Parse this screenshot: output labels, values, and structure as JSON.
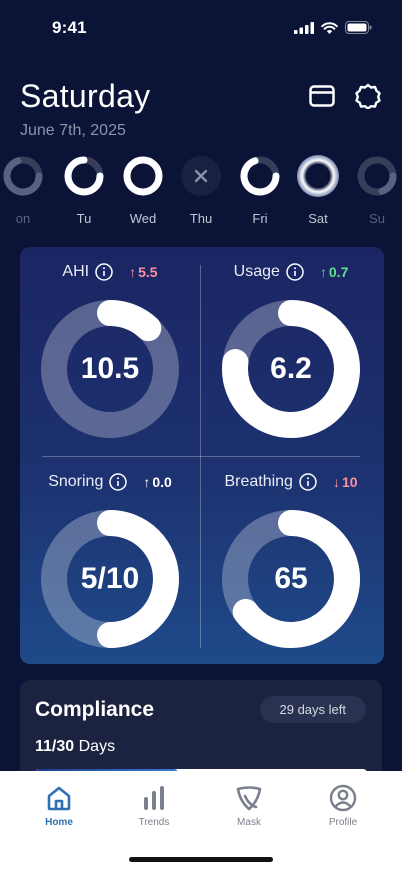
{
  "status_bar": {
    "time": "9:41"
  },
  "header": {
    "day": "Saturday",
    "date": "June 7th, 2025"
  },
  "week": [
    {
      "label": "Mon",
      "display": "on",
      "state": "partial",
      "progress": 0.7,
      "faded": true
    },
    {
      "label": "Tu",
      "display": "Tu",
      "state": "partial",
      "progress": 0.75
    },
    {
      "label": "Wed",
      "display": "Wed",
      "state": "full",
      "progress": 1.0
    },
    {
      "label": "Thu",
      "display": "Thu",
      "state": "missed",
      "progress": 0
    },
    {
      "label": "Fri",
      "display": "Fri",
      "state": "partial",
      "progress": 0.7
    },
    {
      "label": "Sat",
      "display": "Sat",
      "state": "selected",
      "progress": 1.0
    },
    {
      "label": "Sun",
      "display": "Su",
      "state": "partial",
      "progress": 0.2,
      "faded": true
    }
  ],
  "metrics": {
    "ahi": {
      "name": "AHI",
      "value": "10.5",
      "delta": "5.5",
      "direction": "up",
      "delta_color": "#ff8fa3",
      "progress": 0.12
    },
    "usage": {
      "name": "Usage",
      "value": "6.2",
      "delta": "0.7",
      "direction": "up",
      "delta_color": "#5ee28a",
      "progress": 0.77
    },
    "snoring": {
      "name": "Snoring",
      "value": "5/10",
      "delta": "0.0",
      "direction": "up",
      "delta_color": "#ffffff",
      "progress": 0.5
    },
    "breathing": {
      "name": "Breathing",
      "value": "65",
      "delta": "10",
      "direction": "down",
      "delta_color": "#ff8fa3",
      "progress": 0.65
    }
  },
  "compliance": {
    "title": "Compliance",
    "days_left": "29 days left",
    "days_done": "11/30",
    "days_unit": "Days",
    "progress": 0.43
  },
  "tabs": [
    {
      "label": "Home",
      "icon": "home-icon",
      "active": true
    },
    {
      "label": "Trends",
      "icon": "bar-chart-icon",
      "active": false
    },
    {
      "label": "Mask",
      "icon": "mask-icon",
      "active": false
    },
    {
      "label": "Profile",
      "icon": "profile-icon",
      "active": false
    }
  ],
  "colors": {
    "background": "#0b1436",
    "accent": "#2f6fb3",
    "card_gradient_top": "#1b2563",
    "card_gradient_bottom": "#1f4a8a"
  }
}
